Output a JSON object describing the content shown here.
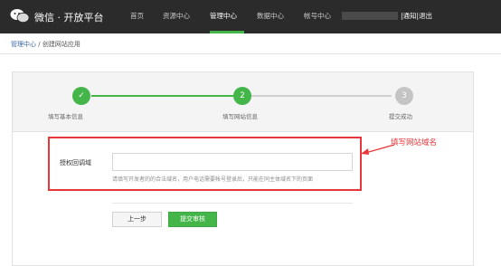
{
  "header": {
    "brand": "微信 · 开放平台",
    "nav": [
      {
        "label": "首页"
      },
      {
        "label": "资源中心"
      },
      {
        "label": "管理中心"
      },
      {
        "label": "数据中心"
      },
      {
        "label": "帐号中心"
      }
    ],
    "active_nav": "管理中心",
    "links": {
      "notify": "通知",
      "sep": "|",
      "logout": "退出",
      "sep2": "|"
    },
    "colors": {
      "bar": "#2b2b2b",
      "accent": "#44b549"
    }
  },
  "breadcrumb": {
    "parent": "管理中心",
    "sep": "/",
    "current": "创建网站应用"
  },
  "steps": [
    {
      "symbol": "✓",
      "label": "填写基本信息",
      "state": "done"
    },
    {
      "symbol": "2",
      "label": "填写网站信息",
      "state": "current"
    },
    {
      "symbol": "3",
      "label": "提交成功",
      "state": "todo"
    }
  ],
  "form": {
    "field_label": "授权回调域",
    "field_value": "",
    "hint": "请填写开发者的的合法域名，用户电话需要帐号登录后，只能在同主体域名下的页面"
  },
  "annotation": "填写网站域名",
  "buttons": {
    "prev": "上一步",
    "submit": "提交审核"
  }
}
